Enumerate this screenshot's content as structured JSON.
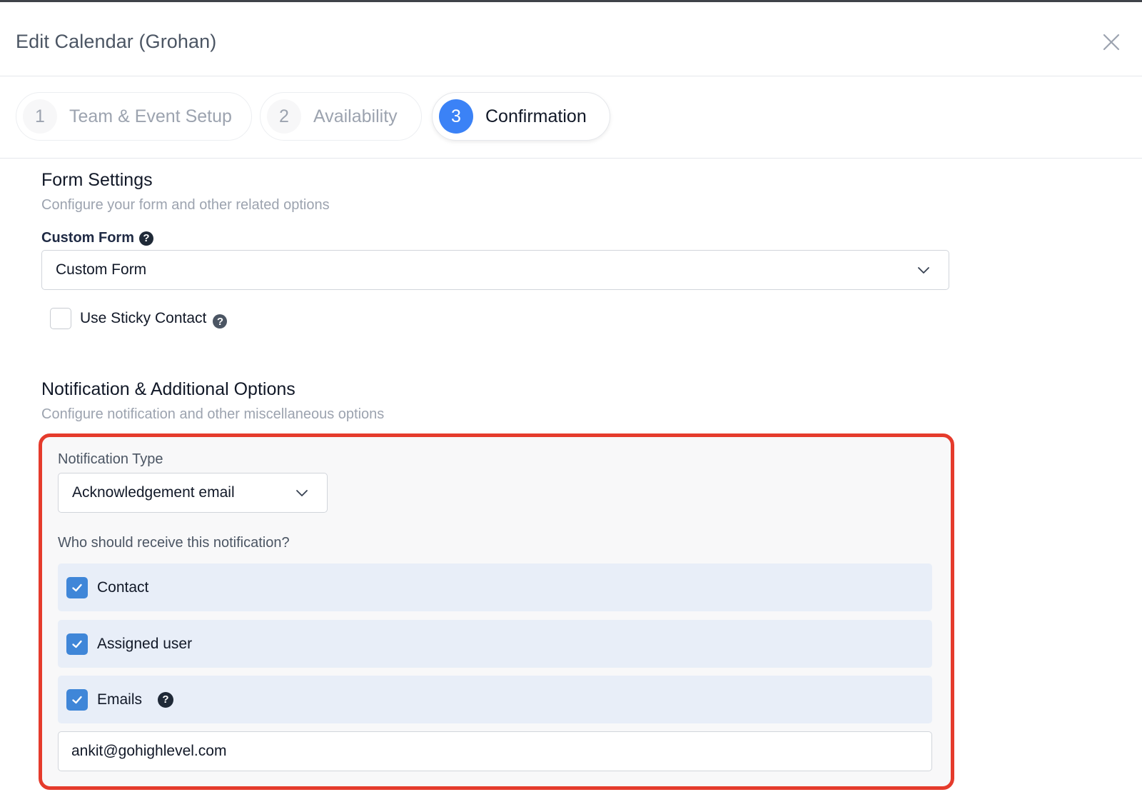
{
  "modal": {
    "title": "Edit Calendar (Grohan)",
    "close_icon": "close-icon"
  },
  "steps": [
    {
      "number": "1",
      "label": "Team & Event Setup",
      "active": false
    },
    {
      "number": "2",
      "label": "Availability",
      "active": false
    },
    {
      "number": "3",
      "label": "Confirmation",
      "active": true
    }
  ],
  "form_settings": {
    "title": "Form Settings",
    "subtitle": "Configure your form and other related options",
    "custom_form_label": "Custom Form",
    "custom_form_value": "Custom Form",
    "help_icon": "question-circle-icon",
    "sticky_contact_label": "Use Sticky Contact",
    "sticky_contact_checked": false
  },
  "notification": {
    "title": "Notification & Additional Options",
    "subtitle": "Configure notification and other miscellaneous options",
    "type_label": "Notification Type",
    "type_value": "Acknowledgement email",
    "recipients_label": "Who should receive this notification?",
    "recipients": [
      {
        "label": "Contact",
        "checked": true
      },
      {
        "label": "Assigned user",
        "checked": true
      },
      {
        "label": "Emails",
        "checked": true
      }
    ],
    "emails_value": "ankit@gohighlevel.com",
    "highlight_color": "#e53b2c",
    "accent_color": "#3b82f6"
  }
}
